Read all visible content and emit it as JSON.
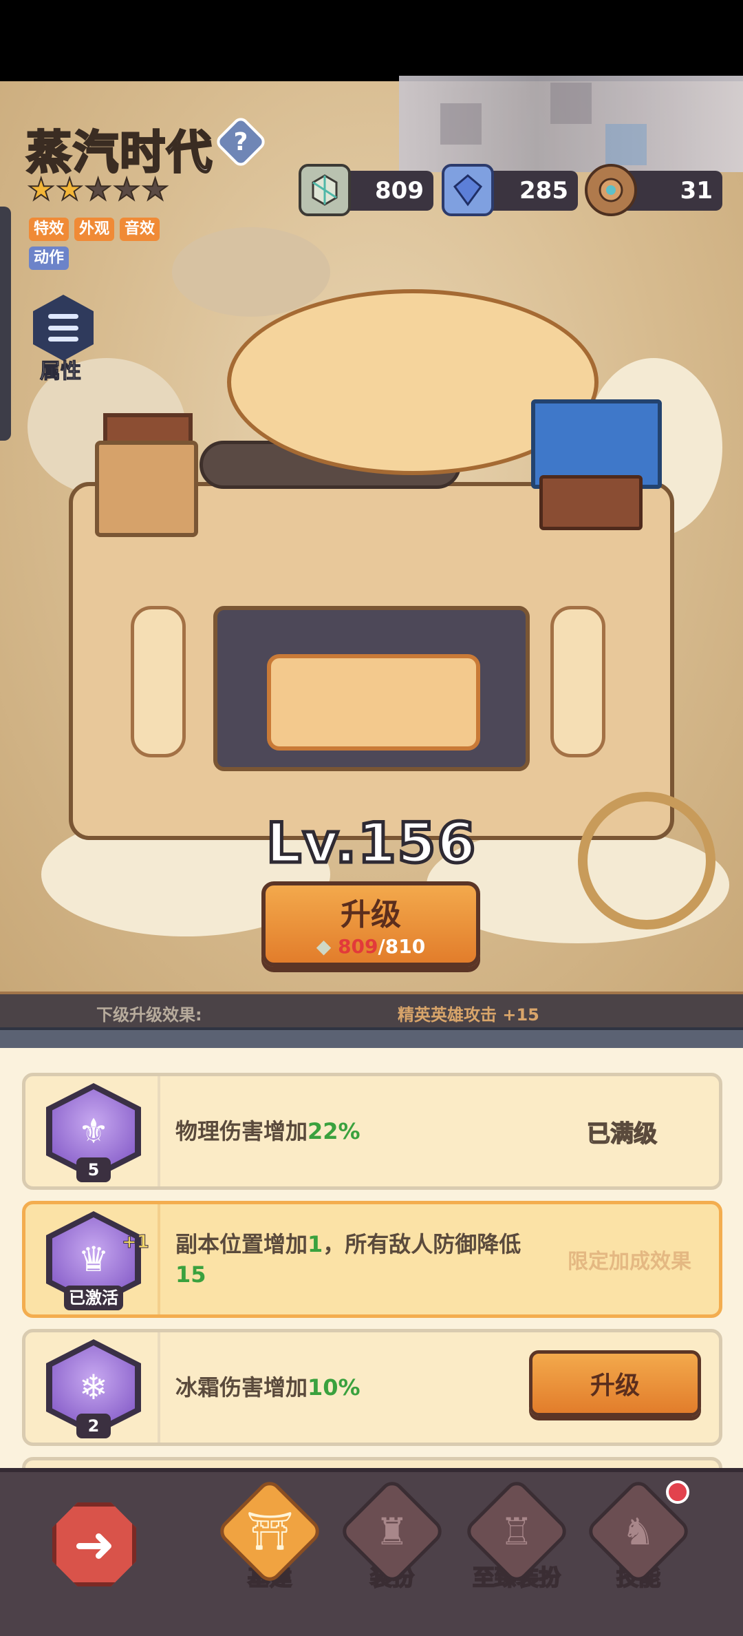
{
  "header": {
    "title": "蒸汽时代",
    "help_icon": "question-icon",
    "help_glyph": "?",
    "stars_filled": 2,
    "stars_total": 5,
    "tags": [
      "特效",
      "外观",
      "音效",
      "动作"
    ],
    "attributes_label": "属性"
  },
  "resources": [
    {
      "icon": "stone-crystal-icon",
      "value": "809"
    },
    {
      "icon": "blue-gem-icon",
      "value": "285"
    },
    {
      "icon": "barrel-token-icon",
      "value": "31"
    }
  ],
  "building": {
    "level_text": "Lv.156",
    "upgrade_label": "升级",
    "cost_have": "809",
    "cost_sep": "/",
    "cost_need": "810"
  },
  "next_effect": {
    "label": "下级升级效果:",
    "value": "精英英雄攻击  +15"
  },
  "effects": [
    {
      "icon": "spear-emblem-icon",
      "badge": "5",
      "text": "物理伤害增加",
      "value": "22%",
      "status": "已满级"
    },
    {
      "icon": "crowned-penguin-icon",
      "badge": "已激活",
      "text_a": "副本位置增加",
      "value_a": "1",
      "text_b": "，所有敌人防御降低",
      "value_b": "15",
      "status": "限定加成效果",
      "plus": "+1"
    },
    {
      "icon": "snowflake-icon",
      "badge": "2",
      "text": "冰霜伤害增加",
      "value": "10%",
      "button": "升级"
    }
  ],
  "nav": {
    "back_icon": "back-arrow-icon",
    "items": [
      {
        "label": "基建",
        "icon": "pillar-icon",
        "active": true
      },
      {
        "label": "装扮",
        "icon": "castle-icon",
        "active": false
      },
      {
        "label": "至臻装扮",
        "icon": "tower-icon",
        "active": false
      },
      {
        "label": "技能",
        "icon": "knight-icon",
        "active": false
      }
    ]
  },
  "colors": {
    "accent_orange": "#f0a341",
    "green_value": "#3aa13e",
    "cost_red": "#e23a3a",
    "panel_bg": "#fbf2dd"
  }
}
